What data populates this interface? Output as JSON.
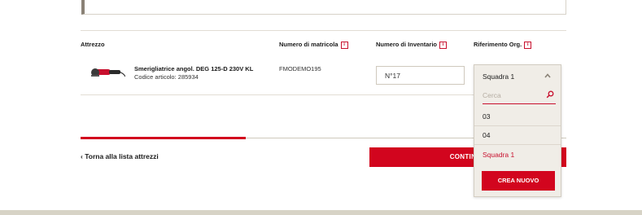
{
  "table": {
    "headers": {
      "tool": "Attrezzo",
      "serial": "Numero di matricola",
      "inventory": "Numero di Inventario",
      "org_ref": "Riferimento Org."
    },
    "info_badge": "i",
    "row": {
      "name": "Smerigliatrice angol. DEG 125-D 230V KL",
      "code": "Codice articolo: 285934",
      "serial": "FMODEMO195",
      "inventory_value": "N°17"
    }
  },
  "dropdown": {
    "selected": "Squadra 1",
    "search_placeholder": "Cerca",
    "options": [
      "03",
      "04",
      "Squadra 1"
    ],
    "create_new": "CREA NUOVO"
  },
  "progress": {
    "fraction": 0.34
  },
  "footer": {
    "back_link": "Torna alla lista attrezzi",
    "continue_label": "CONTINUA"
  },
  "colors": {
    "accent": "#d2051e",
    "beige": "#f0ede7"
  },
  "icons": [
    "angle-grinder-image",
    "info-icon",
    "chevron-up-icon",
    "search-icon",
    "chevron-left-icon"
  ]
}
